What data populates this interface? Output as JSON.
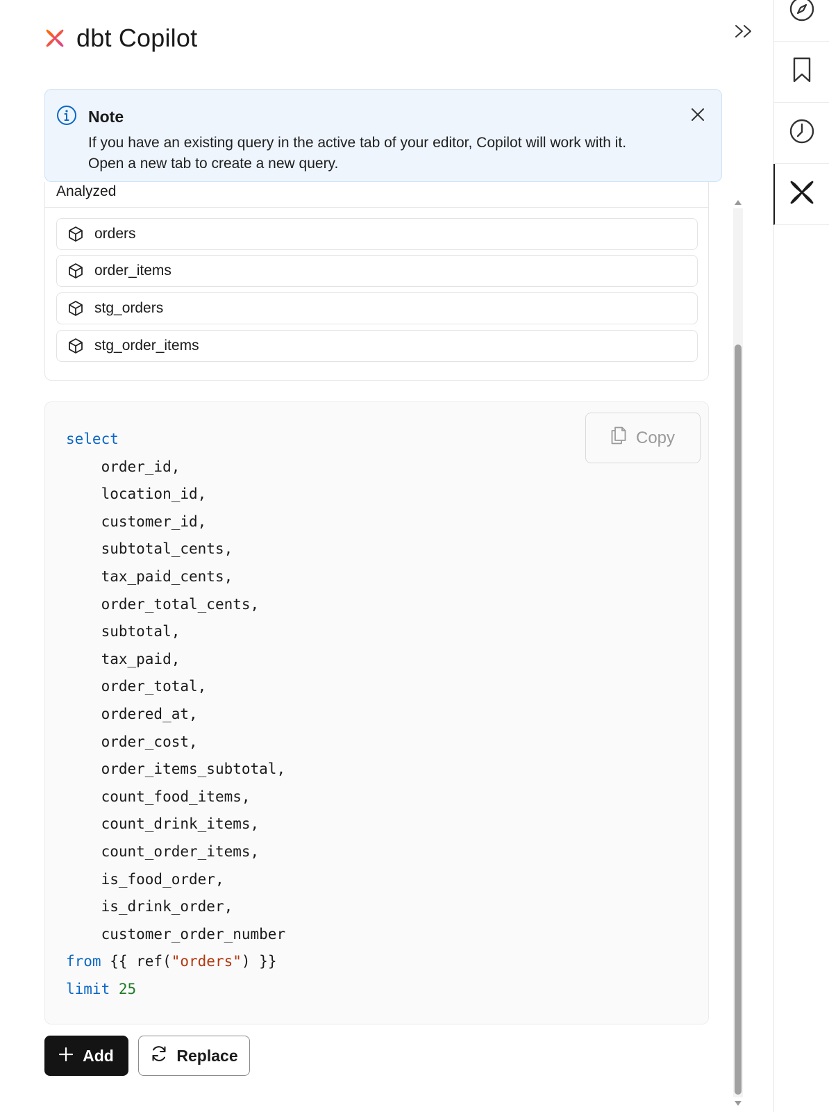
{
  "header": {
    "title": "dbt Copilot",
    "logo_icon": "dbt-copilot-icon",
    "collapse_icon": "chevrons-right-icon"
  },
  "rail": {
    "items": [
      {
        "icon": "compass-icon",
        "active": false
      },
      {
        "icon": "bookmark-icon",
        "active": false
      },
      {
        "icon": "clock-icon",
        "active": false
      },
      {
        "icon": "copilot-icon",
        "active": true
      }
    ]
  },
  "note": {
    "title": "Note",
    "body_line1": "If you have an existing query in the active tab of your editor, Copilot will work with it.",
    "body_line2": "Open a new tab to create a new query."
  },
  "analyzed": {
    "label": "Analyzed",
    "models": [
      {
        "name": "orders"
      },
      {
        "name": "order_items"
      },
      {
        "name": "stg_orders"
      },
      {
        "name": "stg_order_items"
      }
    ]
  },
  "code": {
    "copy_label": "Copy",
    "keyword_select": "select",
    "columns": [
      "order_id,",
      "location_id,",
      "customer_id,",
      "subtotal_cents,",
      "tax_paid_cents,",
      "order_total_cents,",
      "subtotal,",
      "tax_paid,",
      "order_total,",
      "ordered_at,",
      "order_cost,",
      "order_items_subtotal,",
      "count_food_items,",
      "count_drink_items,",
      "count_order_items,",
      "is_food_order,",
      "is_drink_order,",
      "customer_order_number"
    ],
    "keyword_from": "from",
    "ref_open": " {{ ref(",
    "ref_string": "\"orders\"",
    "ref_close": ") }}",
    "keyword_limit": "limit",
    "limit_value": "25"
  },
  "actions": {
    "add_label": "Add",
    "replace_label": "Replace"
  },
  "colors": {
    "note_bg": "#eef5fd",
    "keyword": "#0b67c5",
    "string": "#b4360f",
    "number": "#207a28",
    "primary_button": "#141414"
  }
}
